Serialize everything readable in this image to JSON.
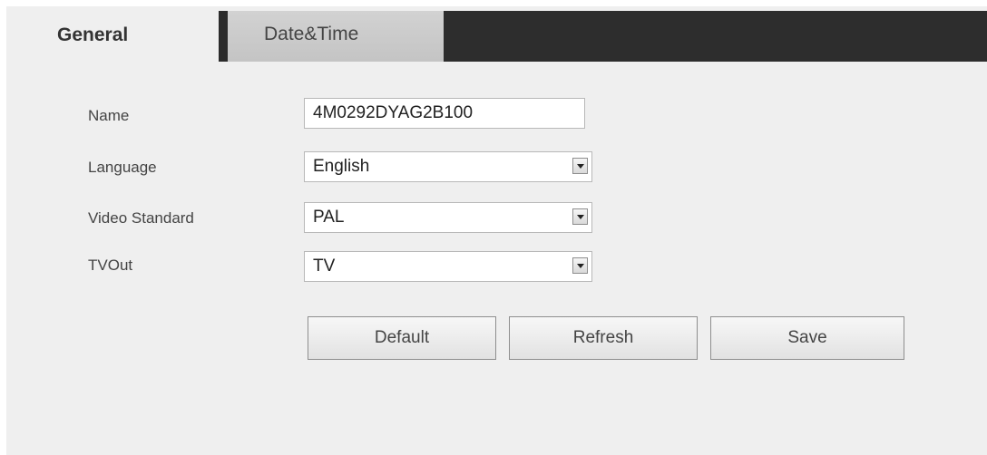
{
  "tabs": [
    {
      "label": "General",
      "active": true
    },
    {
      "label": "Date&Time",
      "active": false
    }
  ],
  "form": {
    "name_label": "Name",
    "name_value": "4M0292DYAG2B100",
    "language_label": "Language",
    "language_value": "English",
    "video_standard_label": "Video Standard",
    "video_standard_value": "PAL",
    "tvout_label": "TVOut",
    "tvout_value": "TV"
  },
  "buttons": {
    "default_label": "Default",
    "refresh_label": "Refresh",
    "save_label": "Save"
  },
  "icons": {
    "dropdown": "chevron-down-icon"
  },
  "colors": {
    "panel_background": "#efefef",
    "tab_bar_dark": "#2d2d2d",
    "inactive_tab": "#c9c9c9"
  }
}
